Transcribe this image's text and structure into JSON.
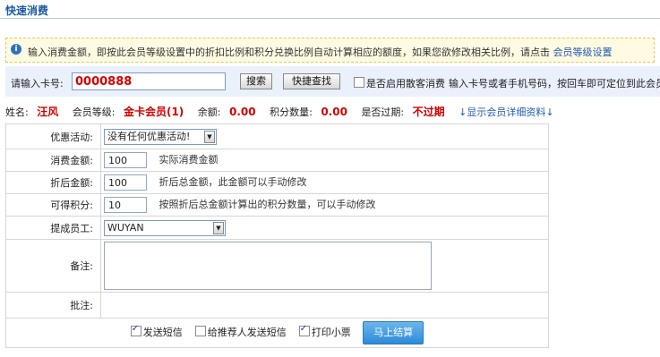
{
  "page": {
    "title": "快速消费"
  },
  "notice": {
    "text": "输入消费金额，即按此会员等级设置中的折扣比例和积分兑换比例自动计算相应的额度，如果您欲修改相关比例，请点击",
    "link": "会员等级设置"
  },
  "search": {
    "card_label": "请输入卡号:",
    "card_value": "0000888",
    "search_btn": "搜索",
    "quick_btn": "快捷查找",
    "guest_label": "是否启用散客消费",
    "hint": "输入卡号或者手机号码，按回车即可定位到此会员!"
  },
  "member": {
    "name_label": "姓名:",
    "name": "汪风",
    "level_label": "会员等级:",
    "level": "金卡会员(1)",
    "balance_label": "余额:",
    "balance": "0.00",
    "points_label": "积分数量:",
    "points": "0.00",
    "expired_label": "是否过期:",
    "expired": "不过期",
    "details_link": "↓显示会员详细资料↓"
  },
  "form": {
    "promo_label": "优惠活动:",
    "promo_value": "没有任何优惠活动!",
    "amount_label": "消费金额:",
    "amount_value": "100",
    "amount_hint": "实际消费金额",
    "discount_label": "折后金额:",
    "discount_value": "100",
    "discount_hint": "折后总金额，此金额可以手动修改",
    "points_label": "可得积分:",
    "points_value": "10",
    "points_hint": "按照折后总金额计算出的积分数量，可以手动修改",
    "staff_label": "提成员工:",
    "staff_value": "WUYAN",
    "remark_label": "备注:",
    "annotation_label": "批注:"
  },
  "actions": {
    "send_sms": "发送短信",
    "send_sms_checked": true,
    "ref_sms": "给推荐人发送短信",
    "ref_sms_checked": false,
    "print": "打印小票",
    "print_checked": true,
    "submit": "马上结算"
  }
}
